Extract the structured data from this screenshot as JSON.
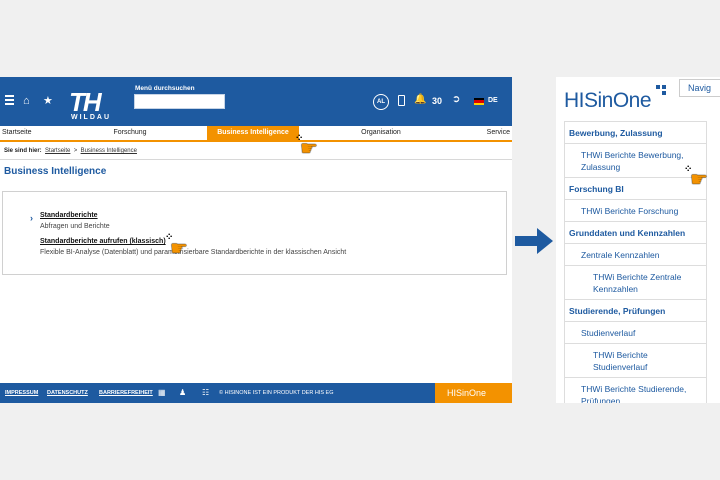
{
  "left_screen": {
    "header": {
      "logo_text": "TH",
      "logo_sub": "WILDAU",
      "search_label": "Menü durchsuchen",
      "avatar_initials": "AL",
      "notification_count": "30",
      "language": "DE",
      "icons": [
        "menu-icon",
        "home-icon",
        "star-icon",
        "phone-icon",
        "bell-icon",
        "logout-icon",
        "german-flag-icon"
      ]
    },
    "nav": {
      "items": [
        "Startseite",
        "Forschung",
        "Business Intelligence",
        "Organisation",
        "Service"
      ],
      "active": "Business Intelligence",
      "active_color": "#f39200"
    },
    "breadcrumb": {
      "prefix": "Sie sind hier:",
      "items": [
        "Startseite",
        "Business Intelligence"
      ],
      "separator": ">"
    },
    "page_title": "Business Intelligence",
    "links": [
      {
        "label": "Standardberichte",
        "description": "Abfragen und Berichte"
      },
      {
        "label": "Standardberichte aufrufen (klassisch)",
        "description": "Flexible BI-Analyse (Datenblatt) und parametrisierbare Standardberichte in der klassischen Ansicht"
      }
    ],
    "footer": {
      "links": [
        "IMPRESSUM",
        "DATENSCHUTZ",
        "BARRIEREFREIHEIT"
      ],
      "copyright": "© HISINONE IST EIN PRODUKT DER HIS EG",
      "brand": "HISinOne"
    }
  },
  "right_screen": {
    "logo": "HISinOne",
    "nav_button": "Navig",
    "menu": [
      {
        "level": "header",
        "label": "Bewerbung, Zulassung"
      },
      {
        "level": 1,
        "label": "THWi Berichte Bewerbung, Zulassung"
      },
      {
        "level": "header",
        "label": "Forschung BI"
      },
      {
        "level": 1,
        "label": "THWi Berichte Forschung"
      },
      {
        "level": "header",
        "label": "Grunddaten und Kennzahlen"
      },
      {
        "level": 1,
        "label": "Zentrale Kennzahlen"
      },
      {
        "level": 2,
        "label": "THWi Berichte Zentrale Kennzahlen"
      },
      {
        "level": "header",
        "label": "Studierende, Prüfungen"
      },
      {
        "level": 1,
        "label": "Studienverlauf"
      },
      {
        "level": 2,
        "label": "THWi Berichte Studienverlauf"
      },
      {
        "level": 1,
        "label": "THWi Berichte Studierende, Prüfungen"
      }
    ]
  },
  "colors": {
    "brand_blue": "#1e5aa0",
    "accent_orange": "#f39200"
  }
}
